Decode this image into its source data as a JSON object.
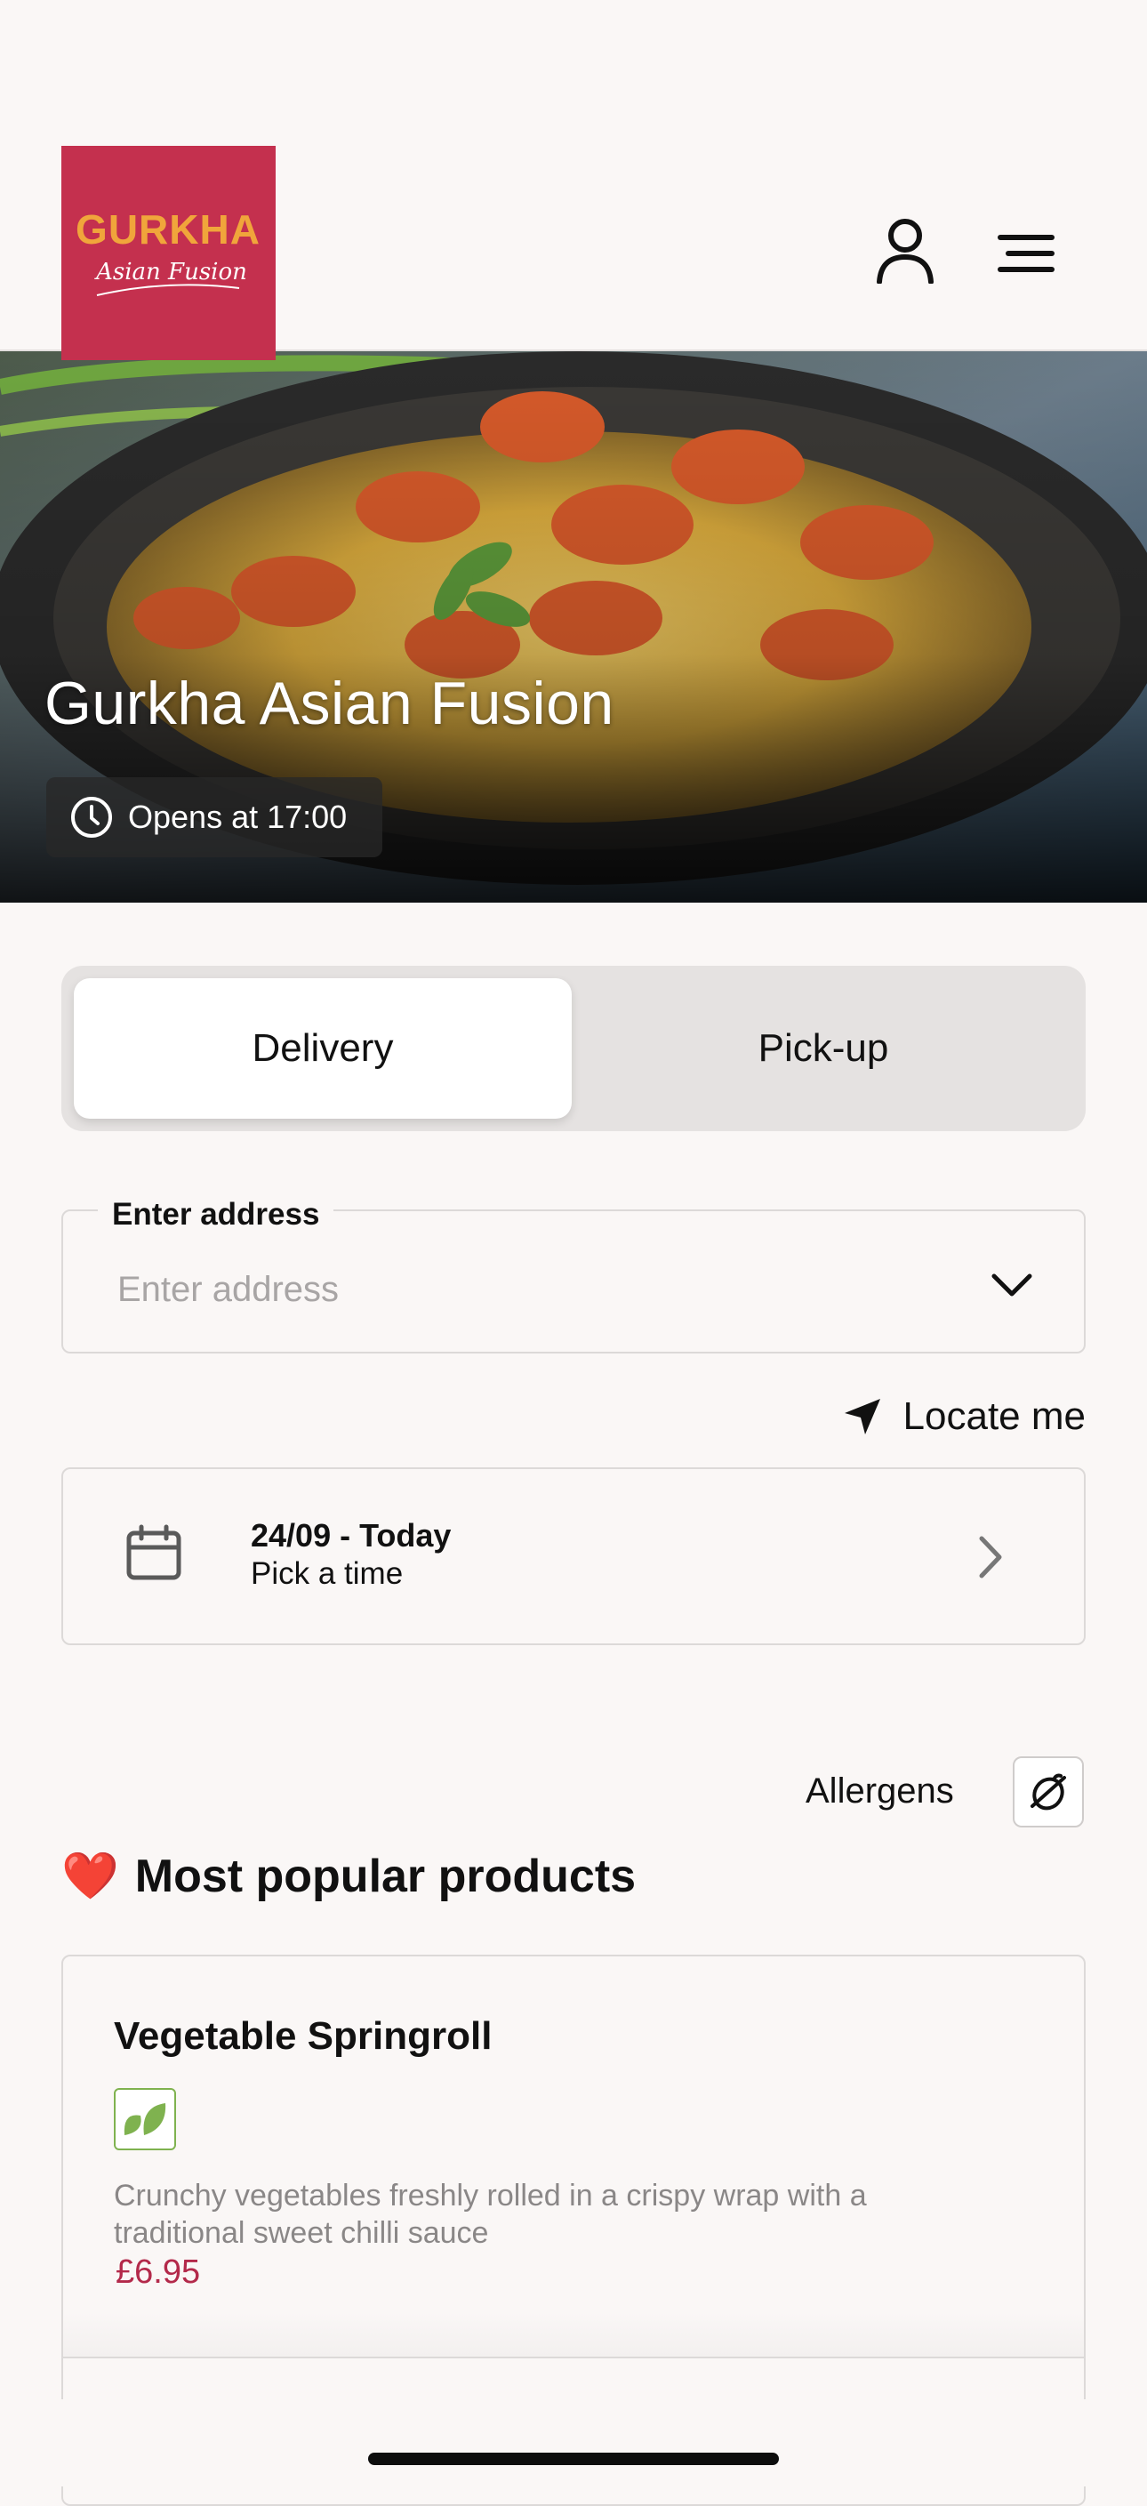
{
  "header": {
    "logo": {
      "text_top": "GURKHA",
      "text_bottom": "Asian Fusion",
      "bg_color": "#c4304e",
      "text_color": "#f0a53b"
    },
    "account_icon": "person-icon",
    "menu_icon": "hamburger-menu-icon"
  },
  "hero": {
    "title": "Gurkha Asian Fusion",
    "hours_icon": "clock-icon",
    "hours_text": "Opens at 17:00"
  },
  "order_mode": {
    "options": [
      "Delivery",
      "Pick-up"
    ],
    "selected": "Delivery"
  },
  "address": {
    "label": "Enter address",
    "placeholder": "Enter address",
    "value": "",
    "dropdown_icon": "chevron-down-icon"
  },
  "locate": {
    "icon": "location-arrow-icon",
    "label": "Locate me"
  },
  "schedule": {
    "icon": "calendar-icon",
    "date_label": "24/09 - Today",
    "time_label": "Pick a time",
    "chevron_icon": "chevron-right-icon"
  },
  "allergens": {
    "label": "Allergens",
    "icon": "allergen-filter-icon"
  },
  "popular": {
    "emoji": "❤️",
    "title": "Most popular products"
  },
  "products": [
    {
      "name": "Vegetable Springroll",
      "badge_icon": "vegan-leaf-icon",
      "description": "Crunchy vegetables freshly rolled in a crispy wrap with a traditional sweet chilli sauce",
      "price": "£6.95"
    }
  ],
  "colors": {
    "background": "#faf7f6",
    "brand": "#c4304e",
    "price": "#b3294a",
    "veg_badge": "#7fb24f"
  }
}
